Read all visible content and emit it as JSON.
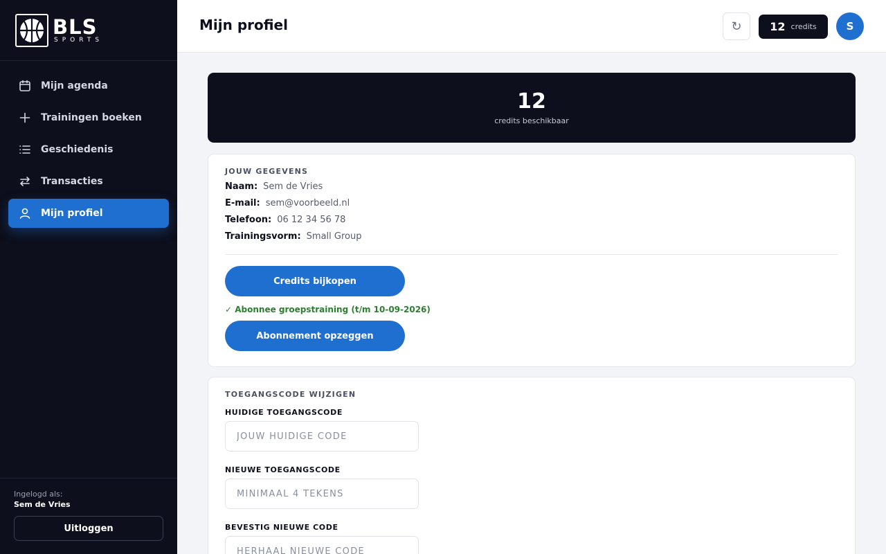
{
  "brand": {
    "title": "BLS",
    "subtitle": "SPORTS"
  },
  "sidebar": {
    "items": [
      {
        "label": "Mijn agenda",
        "icon": "calendar-icon"
      },
      {
        "label": "Trainingen boeken",
        "icon": "plus-icon"
      },
      {
        "label": "Geschiedenis",
        "icon": "list-icon"
      },
      {
        "label": "Transacties",
        "icon": "arrows-swap-icon"
      },
      {
        "label": "Mijn profiel",
        "icon": "user-icon",
        "active": true
      }
    ],
    "footer": {
      "logged_in_label": "Ingelogd als:",
      "user_name": "Sem de Vries",
      "logout_label": "Uitloggen"
    }
  },
  "header": {
    "title": "Mijn profiel",
    "refresh_glyph": "↻",
    "credits_count": "12",
    "credits_label": "credits",
    "avatar_initial": "S"
  },
  "hero": {
    "count": "12",
    "label": "credits beschikbaar"
  },
  "profile": {
    "section_title": "JOUW GEGEVENS",
    "fields": [
      {
        "key": "Naam:",
        "value": "Sem de Vries"
      },
      {
        "key": "E-mail:",
        "value": "sem@voorbeeld.nl"
      },
      {
        "key": "Telefoon:",
        "value": "06 12 34 56 78"
      },
      {
        "key": "Trainingsvorm:",
        "value": "Small Group"
      }
    ],
    "buy_button": "Credits bijkopen",
    "subscription_status": "✓ Abonnee groepstraining (t/m 10-09-2026)",
    "cancel_button": "Abonnement opzeggen"
  },
  "access_code": {
    "section_title": "TOEGANGSCODE WIJZIGEN",
    "current_label": "HUIDIGE TOEGANGSCODE",
    "current_placeholder": "JOUW HUIDIGE CODE",
    "new_label": "NIEUWE TOEGANGSCODE",
    "new_placeholder": "MINIMAAL 4 TEKENS",
    "confirm_label": "BEVESTIG NIEUWE CODE",
    "confirm_placeholder": "HERHAAL NIEUWE CODE"
  },
  "colors": {
    "accent": "#1f6fd1",
    "sidebar_bg": "#0d0f1c",
    "success": "#2e7d32"
  }
}
